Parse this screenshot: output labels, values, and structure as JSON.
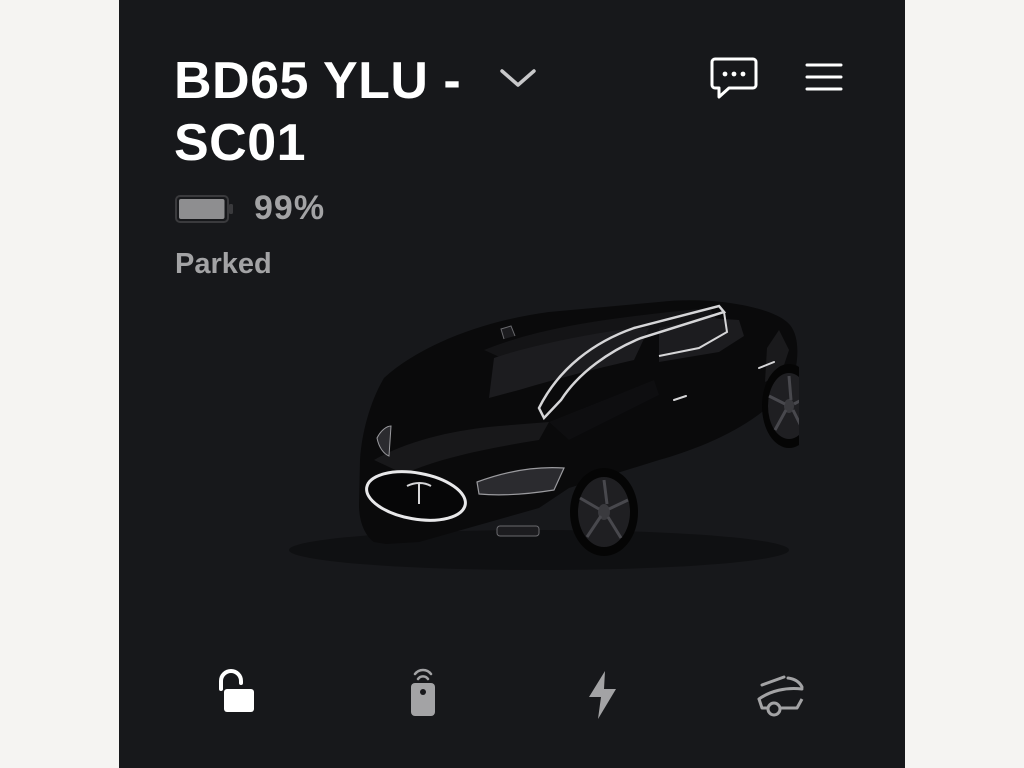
{
  "vehicle": {
    "name": "BD65 YLU - SC01",
    "battery_percent": 99,
    "battery_label": "99%",
    "status": "Parked",
    "color": "#0b0b0c"
  },
  "header": {
    "chevron_icon": "chevron-down-icon",
    "message_icon": "chat-bubble-icon",
    "menu_icon": "hamburger-menu-icon"
  },
  "actions": [
    {
      "icon": "unlock-icon",
      "state": "unlocked",
      "color": "#ffffff"
    },
    {
      "icon": "remote-key-icon",
      "color": "#a3a3a5"
    },
    {
      "icon": "lightning-bolt-icon",
      "color": "#a3a3a5"
    },
    {
      "icon": "frunk-trunk-icon",
      "color": "#a3a3a5"
    }
  ],
  "colors": {
    "background": "#17181b",
    "primary_text": "#ffffff",
    "secondary_text": "#a3a3a5"
  }
}
